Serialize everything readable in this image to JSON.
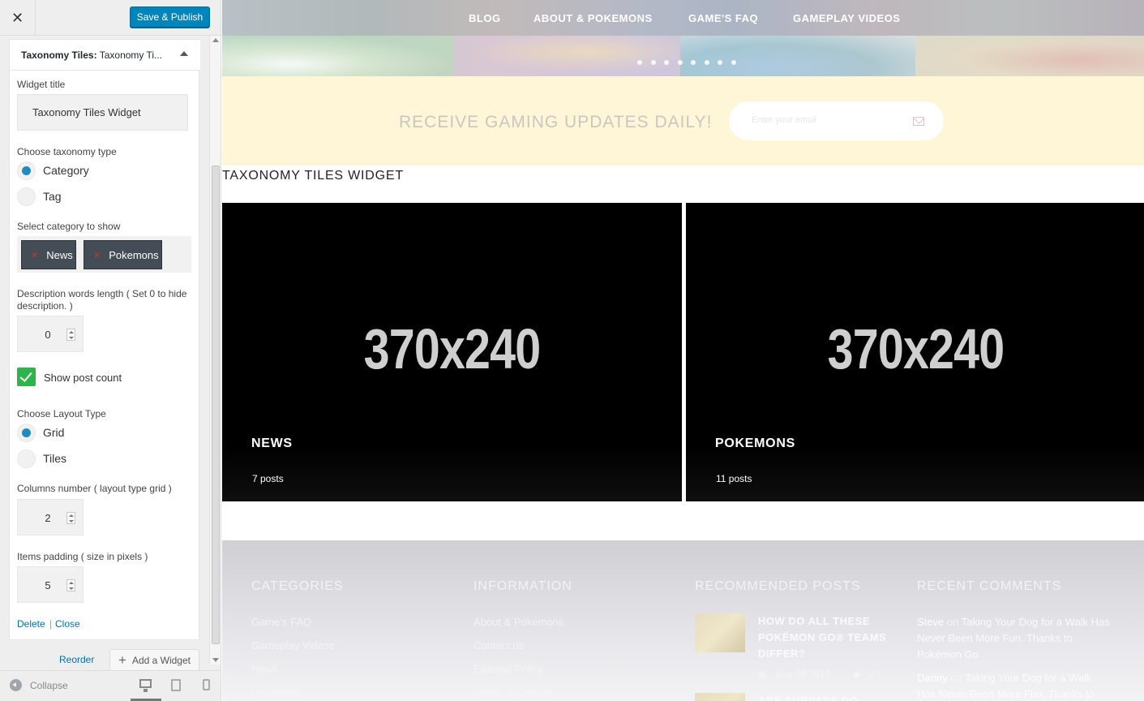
{
  "customizer": {
    "close_icon": "close-icon",
    "publish_label": "Save & Publish",
    "widget": {
      "title_prefix": "Taxonomy Tiles:",
      "title_suffix": "Taxonomy Ti...",
      "widget_title_label": "Widget title",
      "widget_title_value": "Taxonomy Tiles Widget",
      "taxonomy_type_label": "Choose taxonomy type",
      "taxonomy_options": [
        "Category",
        "Tag"
      ],
      "taxonomy_selected": "Category",
      "category_label": "Select category to show",
      "selected_categories": [
        "News",
        "Pokemons"
      ],
      "desc_length_label": "Description words length ( Set 0 to hide description. )",
      "desc_length_value": "0",
      "show_post_count_label": "Show post count",
      "show_post_count_checked": true,
      "layout_label": "Choose Layout Type",
      "layout_options": [
        "Grid",
        "Tiles"
      ],
      "layout_selected": "Grid",
      "columns_label": "Columns number ( layout type grid )",
      "columns_value": "2",
      "padding_label": "Items padding ( size in pixels )",
      "padding_value": "5",
      "delete_label": "Delete",
      "separator": "|",
      "close_label": "Close"
    },
    "reorder_label": "Reorder",
    "add_widget_label": "Add a Widget",
    "collapse_label": "Collapse"
  },
  "site": {
    "nav": [
      "BLOG",
      "ABOUT & POKEMONS",
      "GAME'S FAQ",
      "GAMEPLAY VIDEOS"
    ],
    "slider_dots": 8,
    "newsletter_text": "RECEIVE GAMING UPDATES DAILY!",
    "newsletter_placeholder": "Enter your email",
    "widget_heading": "TAXONOMY TILES WIDGET",
    "tiles": [
      {
        "image_text": "370x240",
        "name": "NEWS",
        "count": "7 posts"
      },
      {
        "image_text": "370x240",
        "name": "POKEMONS",
        "count": "11 posts"
      }
    ],
    "footer": {
      "categories_title": "CATEGORIES",
      "categories": [
        "Game's FAQ",
        "Gameplay Videos",
        "News",
        "Pokemons"
      ],
      "information_title": "INFORMATION",
      "information": [
        "About & Pokemons",
        "Contact us",
        "Editorial Policy",
        "Terms of Service"
      ],
      "recommended_title": "RECOMMENDED POSTS",
      "recommended": [
        {
          "title": "HOW DO ALL THESE POKÉMON GO® TEAMS DIFFER?",
          "date": "Aug 08 2016",
          "comments": "2"
        },
        {
          "title": "ARE SURPASS GO FOLL...",
          "date": "",
          "comments": ""
        }
      ],
      "comments_title": "RECENT COMMENTS",
      "comments": [
        {
          "author": "Steve",
          "on": "on",
          "post": "Taking Your Dog for a Walk Has Never Been More Fun, Thanks to Pokémon Go"
        },
        {
          "author": "Danny",
          "on": "on",
          "post": "Taking Your Dog for a Walk Has Never Been More Fun, Thanks to Pokémon Go"
        }
      ]
    }
  },
  "colors": {
    "publish": "#0085ba",
    "checkbox": "#2db44a",
    "radio": "#1e8cbe",
    "newsletter_bg": "#fff6d7"
  }
}
